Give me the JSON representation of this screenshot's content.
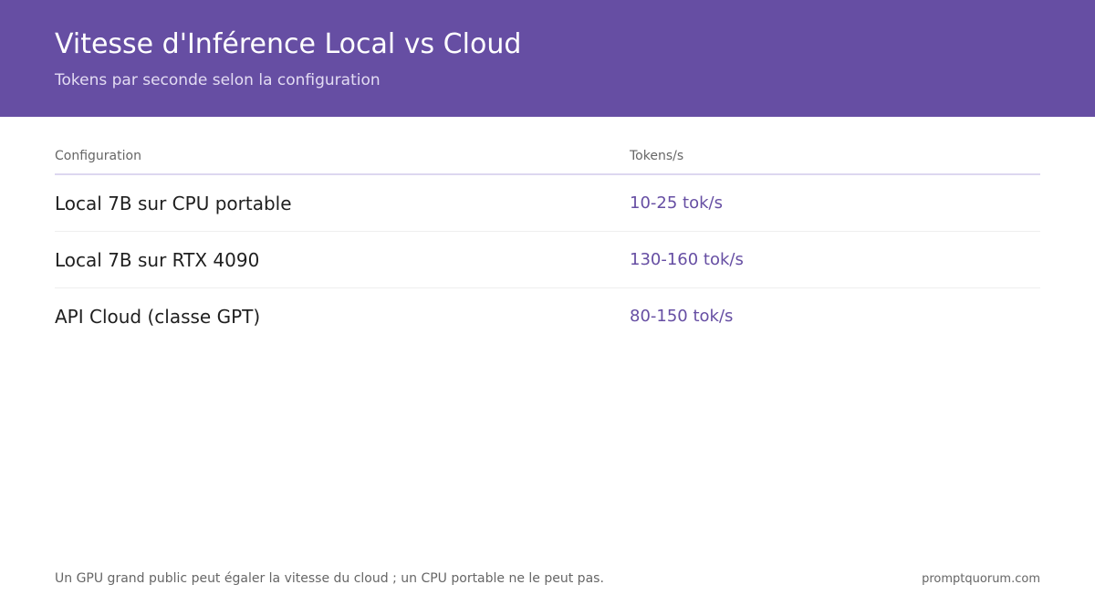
{
  "header": {
    "title": "Vitesse d'Inférence Local vs Cloud",
    "subtitle": "Tokens par seconde selon la configuration"
  },
  "chart_data": {
    "type": "table",
    "title": "Vitesse d'Inférence Local vs Cloud",
    "subtitle": "Tokens par seconde selon la configuration",
    "columns": [
      "Configuration",
      "Tokens/s"
    ],
    "rows": [
      {
        "configuration": "Local 7B sur CPU portable",
        "tokens_per_second": "10-25 tok/s"
      },
      {
        "configuration": "Local 7B sur RTX 4090",
        "tokens_per_second": "130-160 tok/s"
      },
      {
        "configuration": "API Cloud (classe GPT)",
        "tokens_per_second": "80-150 tok/s"
      }
    ],
    "colors": {
      "header_background": "#664ea3",
      "value_text": "#664ea3"
    }
  },
  "footer": {
    "note": "Un GPU grand public peut égaler la vitesse du cloud ; un CPU portable ne le peut pas.",
    "source": "promptquorum.com"
  }
}
